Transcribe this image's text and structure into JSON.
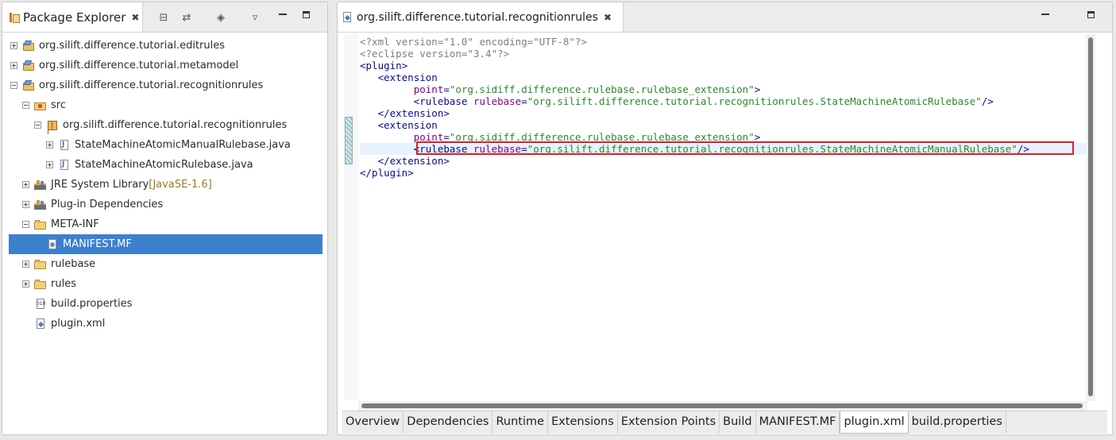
{
  "explorer": {
    "title": "Package Explorer",
    "tree": [
      {
        "label": "org.silift.difference.tutorial.editrules",
        "icon": "project-icon",
        "indent": 0,
        "expander": "plus"
      },
      {
        "label": "org.silift.difference.tutorial.metamodel",
        "icon": "project-icon",
        "indent": 0,
        "expander": "plus"
      },
      {
        "label": "org.silift.difference.tutorial.recognitionrules",
        "icon": "project-icon",
        "indent": 0,
        "expander": "minus"
      },
      {
        "label": "src",
        "icon": "source-folder-icon",
        "indent": 1,
        "expander": "minus"
      },
      {
        "label": "org.silift.difference.tutorial.recognitionrules",
        "icon": "package-icon",
        "indent": 2,
        "expander": "minus"
      },
      {
        "label": "StateMachineAtomicManualRulebase.java",
        "icon": "java-file-icon",
        "indent": 3,
        "expander": "plus"
      },
      {
        "label": "StateMachineAtomicRulebase.java",
        "icon": "java-file-icon",
        "indent": 3,
        "expander": "plus"
      },
      {
        "label": "JRE System Library",
        "suffix": "[JavaSE-1.6]",
        "icon": "library-icon",
        "indent": 1,
        "expander": "plus"
      },
      {
        "label": "Plug-in Dependencies",
        "icon": "library-icon",
        "indent": 1,
        "expander": "plus"
      },
      {
        "label": "META-INF",
        "icon": "folder-icon",
        "indent": 1,
        "expander": "minus"
      },
      {
        "label": "MANIFEST.MF",
        "icon": "manifest-file-icon",
        "indent": 2,
        "expander": "none",
        "selected": true
      },
      {
        "label": "rulebase",
        "icon": "folder-icon",
        "indent": 1,
        "expander": "plus"
      },
      {
        "label": "rules",
        "icon": "folder-icon",
        "indent": 1,
        "expander": "plus"
      },
      {
        "label": "build.properties",
        "icon": "properties-file-icon",
        "indent": 1,
        "expander": "none"
      },
      {
        "label": "plugin.xml",
        "icon": "plugin-xml-icon",
        "indent": 1,
        "expander": "none"
      }
    ]
  },
  "editor": {
    "tab_title": "org.silift.difference.tutorial.recognitionrules",
    "code_lines": [
      "<?xml version=\"1.0\" encoding=\"UTF-8\"?>",
      "<?eclipse version=\"3.4\"?>",
      "<plugin>",
      "   <extension",
      "         point=\"org.sidiff.difference.rulebase.rulebase_extension\">",
      "         <rulebase rulebase=\"org.silift.difference.tutorial.recognitionrules.StateMachineAtomicRulebase\"/>",
      "   </extension>",
      "   <extension",
      "         point=\"org.sidiff.difference.rulebase.rulebase_extension\">",
      "         <rulebase rulebase=\"org.silift.difference.tutorial.recognitionrules.StateMachineAtomicManualRulebase\"/>",
      "   </extension>",
      "</plugin>"
    ],
    "current_line": 9,
    "page_tabs": [
      "Overview",
      "Dependencies",
      "Runtime",
      "Extensions",
      "Extension Points",
      "Build",
      "MANIFEST.MF",
      "plugin.xml",
      "build.properties"
    ],
    "active_page_tab": "plugin.xml"
  },
  "colors": {
    "selection": "#3d80ce",
    "highlight_box": "#d3202a",
    "xml_tag": "#0c0c8c",
    "xml_attr": "#7f007f",
    "xml_value": "#2a8a2a"
  }
}
